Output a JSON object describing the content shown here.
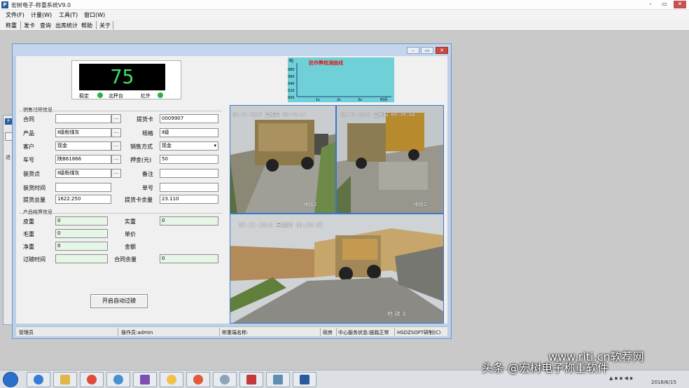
{
  "app": {
    "icon_label": "P",
    "title": "宏树电子-称重系统V9.0"
  },
  "menu": [
    "文件(F)",
    "计量(W)",
    "工具(T)",
    "窗口(W)"
  ],
  "toolbar": [
    "称重",
    "发卡",
    "查询",
    "出库统计",
    "帮助",
    "关于"
  ],
  "scale": {
    "value": "75",
    "stable_label": "稳定",
    "station_label": "北秤台",
    "ir_label": "红外"
  },
  "chart": {
    "title": "防作弊检测曲线",
    "y_unit": "吨",
    "y_ticks": [
      "080",
      "060",
      "040",
      "020",
      "000"
    ],
    "x_ticks": [
      "1s",
      "2s",
      "3s"
    ],
    "x_unit": "时间"
  },
  "chart_data": {
    "type": "line",
    "title": "防作弊检测曲线",
    "xlabel": "时间",
    "ylabel": "吨",
    "x_ticks": [
      "1s",
      "2s",
      "3s"
    ],
    "ylim": [
      0,
      80
    ],
    "series": []
  },
  "sales": {
    "group_title": "销售过磅信息",
    "contract_label": "合同",
    "contract_value": "",
    "card_label": "提货卡",
    "card_value": "0009907",
    "product_label": "产品",
    "product_value": "Ⅱ级粉煤灰",
    "spec_label": "规格",
    "spec_value": "Ⅱ级",
    "customer_label": "客户",
    "customer_value": "现金",
    "sale_method_label": "销售方式",
    "sale_method_value": "现金",
    "plate_label": "车号",
    "plate_value": "陕B61866",
    "deposit_label": "押金(元)",
    "deposit_value": "50",
    "load_point_label": "装货点",
    "load_point_value": "Ⅱ级粉煤灰",
    "remark_label": "备注",
    "remark_value": "",
    "load_time_label": "装货时间",
    "load_time_value": "",
    "doc_no_label": "单号",
    "doc_no_value": "",
    "pickup_total_label": "提货总量",
    "pickup_total_value": "1622.250",
    "card_balance_label": "提货卡余量",
    "card_balance_value": "23.110",
    "ellipsis": "..."
  },
  "settle": {
    "group_title": "产品结算信息",
    "tare_label": "皮重",
    "tare_value": "0",
    "net_actual_label": "实重",
    "net_actual_value": "0",
    "gross_label": "毛重",
    "gross_value": "0",
    "unit_price_label": "单价",
    "net_label": "净重",
    "net_value": "0",
    "amount_label": "金额",
    "weigh_time_label": "过磅时间",
    "weigh_time_value": "",
    "contract_balance_label": "合同余量",
    "contract_balance_value": "0",
    "auto_button": "开启自动过磅"
  },
  "cameras": {
    "cam1_ts": "05-31-2018 星期四 09:46:14",
    "cam1_tag": "地磅2",
    "cam2_ts": "05-31-2018 星期四 09:39:04",
    "cam2_tag": "地磅2",
    "cam3_ts": "05-31-2018 星期四 09:39:05",
    "cam3_tag": "地 磅 3"
  },
  "status": {
    "role": "管理员",
    "operator": "操作员:admin",
    "scale_name": "称重端名称:",
    "link": "磅房",
    "service": "中心服务状态:链路正常",
    "vendor": "HSDZSOFT研制(C)"
  },
  "bg_window": {
    "icon_label": "P",
    "label": "退"
  },
  "taskbar": {
    "clock": "2018/6/15"
  },
  "watermark": {
    "site": "www.riti.cn软荐网",
    "source": "头条 @宏树电子称重软件"
  },
  "colors": {
    "accent": "#2a5a9e",
    "scale_digits": "#3fdc6a",
    "chart_bg": "#6fd0d8",
    "chart_title": "#e01818"
  }
}
